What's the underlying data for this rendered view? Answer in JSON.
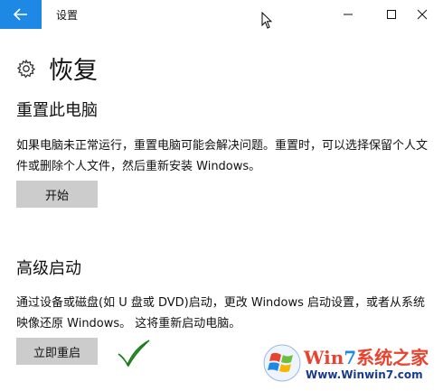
{
  "window": {
    "title": "设置"
  },
  "page": {
    "title": "恢复"
  },
  "reset_section": {
    "title": "重置此电脑",
    "description": "如果电脑未正常运行，重置电脑可能会解决问题。重置时，可以选择保留个人文件或删除个人文件，然后重新安装 Windows。",
    "button_label": "开始"
  },
  "advanced_section": {
    "title": "高级启动",
    "description": "通过设备或磁盘(如 U 盘或 DVD)启动，更改 Windows 启动设置，或者从系统映像还原 Windows。 这将重新启动电脑。",
    "button_label": "立即重启"
  },
  "watermark": {
    "brand_prefix": "Win",
    "brand_seven": "7",
    "brand_suffix": "系统之家",
    "url": "Www.Winwin7.com"
  },
  "colors": {
    "accent": "#1e88e5",
    "button_bg": "#cccccc",
    "checkmark": "#2e9e2e"
  }
}
